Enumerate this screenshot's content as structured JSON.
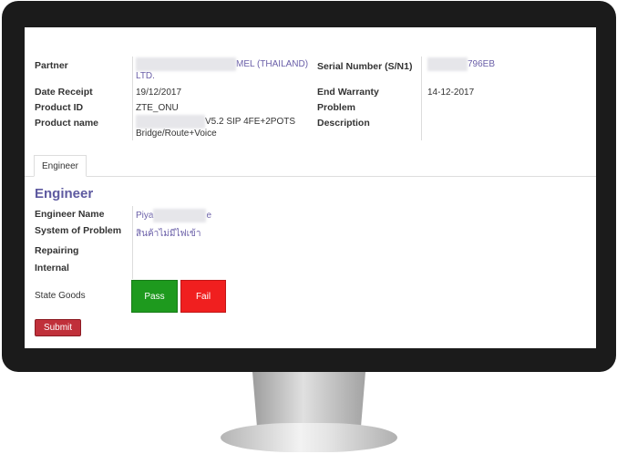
{
  "form": {
    "partner_label": "Partner",
    "partner_value_line1": "MEL (THAILAND)",
    "partner_value_line2": "LTD.",
    "serial_label": "Serial Number (S/N1)",
    "serial_value": "796EB",
    "date_receipt_label": "Date Receipt",
    "date_receipt_value": "19/12/2017",
    "end_warranty_label": "End Warranty",
    "end_warranty_value": "14-12-2017",
    "product_id_label": "Product ID",
    "product_id_value": "ZTE_ONU",
    "problem_label": "Problem",
    "product_name_label": "Product name",
    "product_name_line1": "V5.2 SIP 4FE+2POTS",
    "product_name_line2": "Bridge/Route+Voice",
    "description_label": "Description"
  },
  "tabs": [
    {
      "label": "Engineer"
    }
  ],
  "engineer": {
    "heading": "Engineer",
    "engineer_name_label": "Engineer Name",
    "engineer_name_prefix": "Piya",
    "engineer_name_suffix": "e",
    "system_problem_label": "System of Problem",
    "system_problem_value": "สินค้าไม่มีไฟเข้า",
    "repairing_label": "Repairing",
    "internal_label": "Internal",
    "state_goods_label": "State Goods",
    "pass_label": "Pass",
    "fail_label": "Fail",
    "submit_label": "Submit"
  },
  "colors": {
    "accent": "#5e5aa0",
    "pass": "#1e9a1e",
    "fail": "#f01f1f",
    "submit": "#c0303a",
    "bezel": "#1b1b1b"
  }
}
